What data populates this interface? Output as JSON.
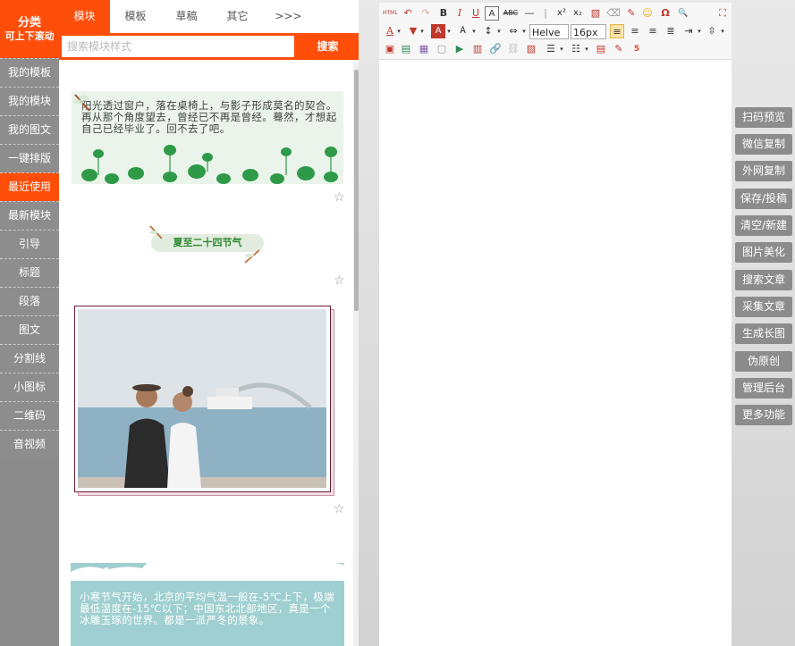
{
  "categories": {
    "header_line1": "分类",
    "header_line2": "可上下滚动",
    "items": [
      {
        "label": "我的模板"
      },
      {
        "label": "我的模块"
      },
      {
        "label": "我的图文"
      },
      {
        "label": "一键排版"
      },
      {
        "label": "最近使用",
        "active": true
      },
      {
        "label": "最新模块"
      },
      {
        "label": "引导"
      },
      {
        "label": "标题"
      },
      {
        "label": "段落"
      },
      {
        "label": "图文"
      },
      {
        "label": "分割线"
      },
      {
        "label": "小图标"
      },
      {
        "label": "二维码"
      },
      {
        "label": "音视频"
      }
    ]
  },
  "panel": {
    "tabs": [
      "模块",
      "模板",
      "草稿",
      "其它",
      ">>>"
    ],
    "search": {
      "placeholder": "搜索模块样式",
      "value": "",
      "button": "搜索"
    },
    "templates": [
      {
        "text": "阳光透过窗户，落在桌椅上，与影子形成莫名的契合。再从那个角度望去，曾经已不再是曾经。蓦然，才想起自己已经毕业了。回不去了吧。"
      },
      {
        "text": "夏至二十四节气"
      },
      {
        "text": ""
      },
      {
        "text": "小寒节气开始，北京的平均气温一般在-5℃上下，极端最低温度在-15℃以下；中国东北北部地区，真是一个冰雕玉琢的世界。都是一派严冬的景象。"
      }
    ]
  },
  "toolbar": {
    "row1": [
      "HTML",
      "↶",
      "↷",
      "B",
      "I",
      "U",
      "A",
      "ABC",
      "—",
      "|",
      "x²",
      "x₂",
      "▧",
      "⌫",
      "✎",
      "☺",
      "Ω",
      "🔍",
      "⛶"
    ],
    "font_family": "Helve",
    "font_size": "16px"
  },
  "functions": [
    "扫码预览",
    "微信复制",
    "外网复制",
    "保存/投稿",
    "清空/新建",
    "图片美化",
    "搜索文章",
    "采集文章",
    "生成长图",
    "伪原创",
    "管理后台",
    "更多功能"
  ],
  "colors": {
    "accent": "#ff4e0a",
    "sidebar": "#8b8b8b",
    "function_button": "#8c8c8c"
  }
}
